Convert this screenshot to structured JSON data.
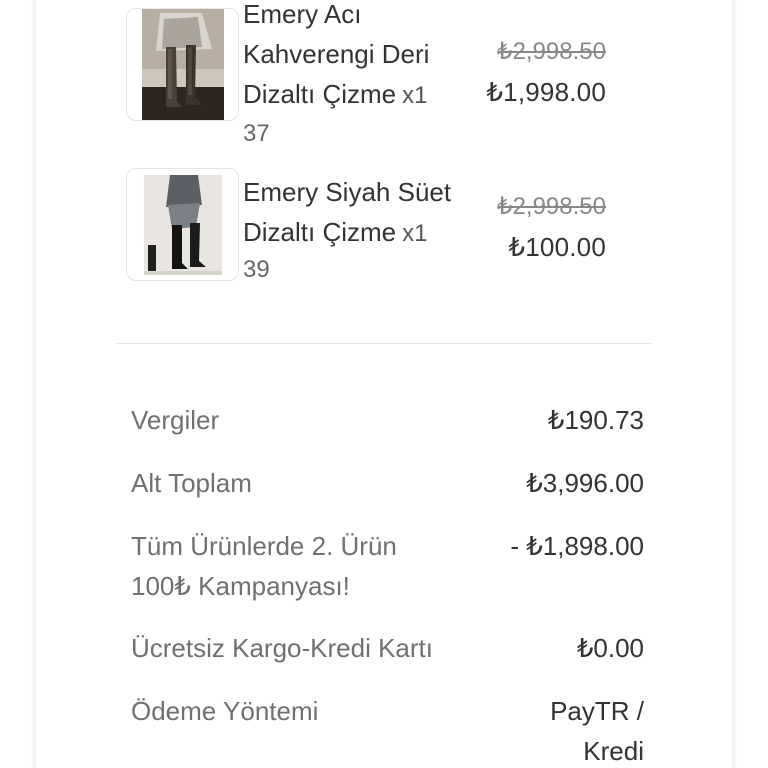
{
  "products": [
    {
      "name": "Emery Acı Kahverengi Deri Dizaltı Çizme",
      "quantity": "x1",
      "size": "37",
      "old_price": "₺2,998.50",
      "new_price": "₺1,998.00",
      "image": "brown-leather-knee-boots-photo"
    },
    {
      "name": "Emery Siyah Süet Dizaltı Çizme",
      "quantity": "x1",
      "size": "39",
      "old_price": "₺2,998.50",
      "new_price": "₺100.00",
      "image": "black-suede-knee-boots-photo"
    }
  ],
  "summary": {
    "tax_label": "Vergiler",
    "tax_value": "₺190.73",
    "subtotal_label": "Alt Toplam",
    "subtotal_value": "₺3,996.00",
    "campaign_label": "Tüm Ürünlerde 2. Ürün 100₺ Kampanyası!",
    "campaign_value": "- ₺1,898.00",
    "shipping_label": "Ücretsiz Kargo-Kredi Kartı",
    "shipping_value": "₺0.00",
    "payment_label": "Ödeme Yöntemi",
    "payment_value": "PayTR / Kredi"
  }
}
